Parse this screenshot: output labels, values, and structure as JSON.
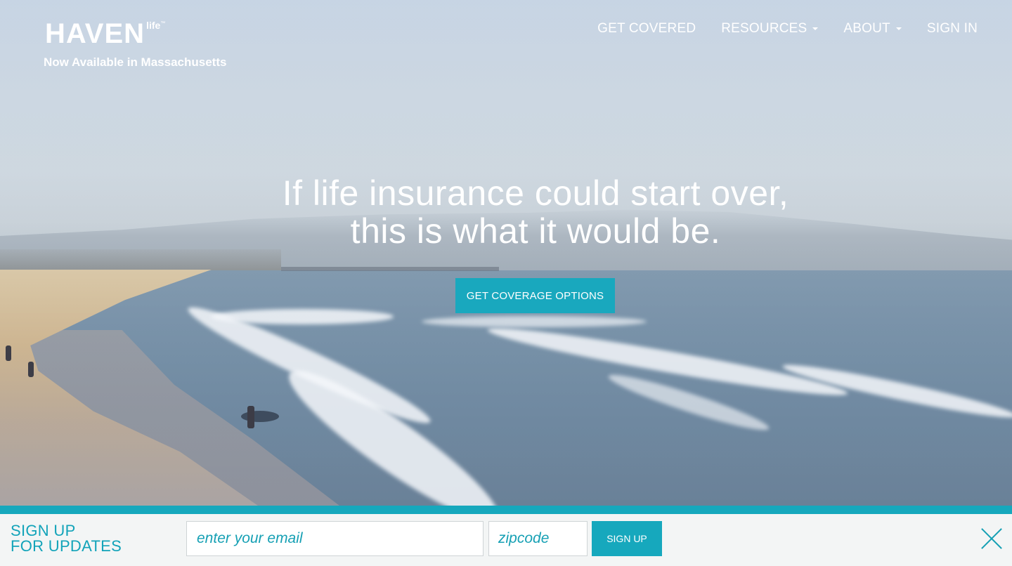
{
  "brand": {
    "logo_word": "HAVEN",
    "logo_sub": "life",
    "logo_tm": "™",
    "tagline": "Now Available in Massachusetts"
  },
  "nav": {
    "items": [
      {
        "label": "GET COVERED",
        "dropdown": false
      },
      {
        "label": "RESOURCES",
        "dropdown": true
      },
      {
        "label": "ABOUT",
        "dropdown": true
      },
      {
        "label": "SIGN IN",
        "dropdown": false
      }
    ]
  },
  "hero": {
    "headline_line1": "If life insurance could start over,",
    "headline_line2": "this is what it would be.",
    "cta_label": "GET COVERAGE OPTIONS"
  },
  "signup": {
    "title_line1": "SIGN UP",
    "title_line2": "FOR UPDATES",
    "email_placeholder": "enter your email",
    "zip_placeholder": "zipcode",
    "button_label": "SIGN UP",
    "close_icon": "close-icon"
  },
  "colors": {
    "accent": "#16a8bd",
    "accent_text": "#12a3b9",
    "header_text": "#ffffff",
    "bar_background": "#f3f5f5"
  }
}
